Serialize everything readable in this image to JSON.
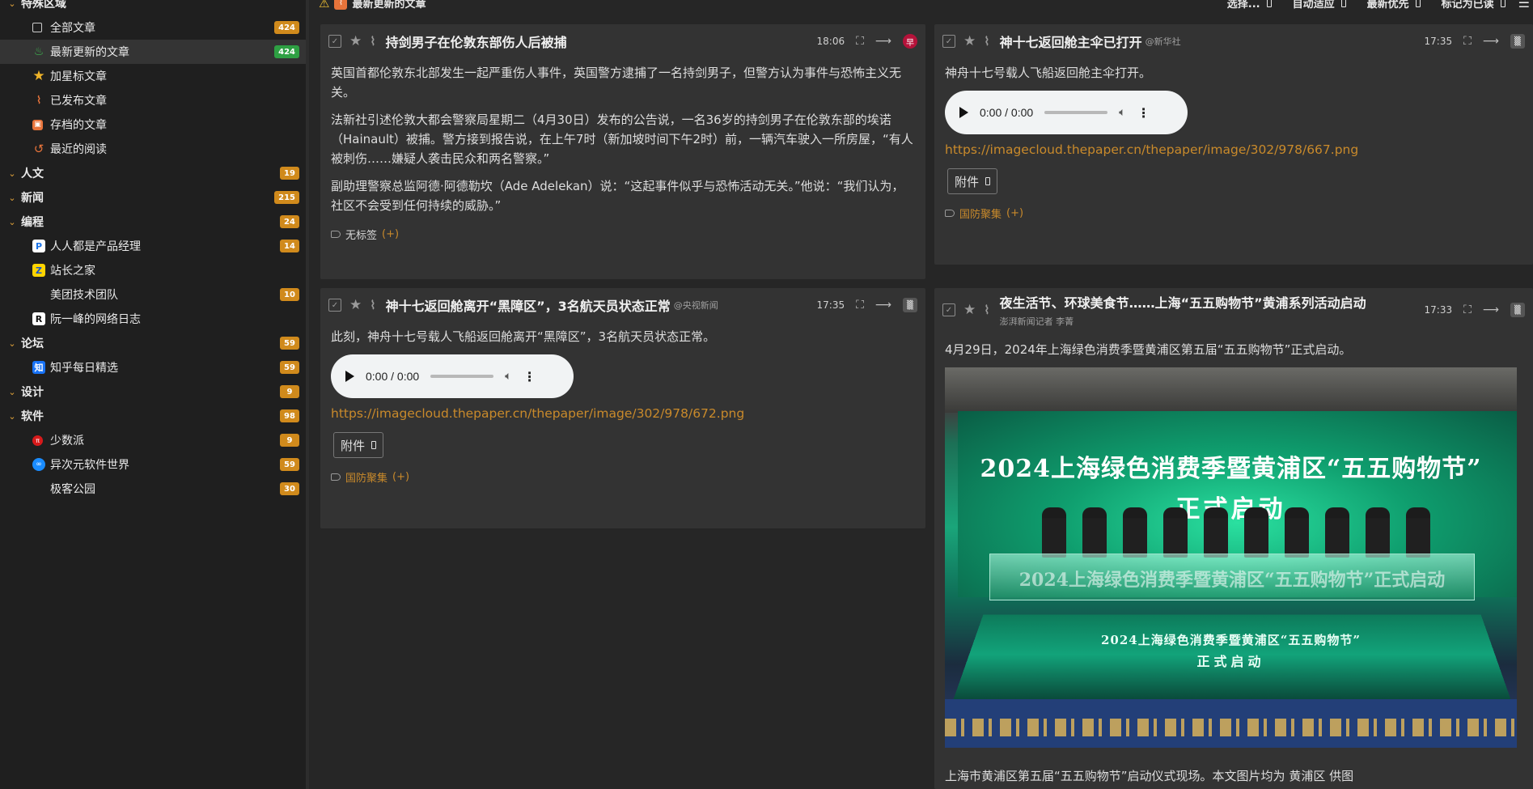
{
  "topbar": {
    "feed_title": "最新更新的文章",
    "actions": [
      "选择...",
      "自动适应",
      "最新优先",
      "标记为已读"
    ]
  },
  "sidebar": {
    "items": [
      {
        "label": "特殊区域",
        "type": "cat"
      },
      {
        "label": "全部文章",
        "badge": "424",
        "icon": "all-articles-icon"
      },
      {
        "label": "最新更新的文章",
        "badge": "424",
        "badge_color": "green",
        "icon": "fresh-icon",
        "active": true
      },
      {
        "label": "加星标文章",
        "icon": "star-icon"
      },
      {
        "label": "已发布文章",
        "icon": "rss-icon"
      },
      {
        "label": "存档的文章",
        "icon": "archive-icon"
      },
      {
        "label": "最近的阅读",
        "icon": "history-icon"
      },
      {
        "label": "人文",
        "badge": "19",
        "type": "cat"
      },
      {
        "label": "新闻",
        "badge": "215",
        "type": "cat"
      },
      {
        "label": "编程",
        "badge": "24",
        "type": "cat"
      },
      {
        "label": "人人都是产品经理",
        "badge": "14",
        "icon": "woshipm-icon"
      },
      {
        "label": "站长之家",
        "icon": "chinaz-icon"
      },
      {
        "label": "美团技术团队",
        "badge": "10"
      },
      {
        "label": "阮一峰的网络日志",
        "icon": "ruanyf-icon"
      },
      {
        "label": "论坛",
        "badge": "59",
        "type": "cat"
      },
      {
        "label": "知乎每日精选",
        "badge": "59",
        "icon": "zhihu-icon"
      },
      {
        "label": "设计",
        "badge": "9",
        "type": "cat"
      },
      {
        "label": "软件",
        "badge": "98",
        "type": "cat"
      },
      {
        "label": "少数派",
        "badge": "9",
        "icon": "sspai-icon"
      },
      {
        "label": "异次元软件世界",
        "badge": "59",
        "icon": "iplaysoft-icon"
      },
      {
        "label": "极客公园",
        "badge": "30"
      }
    ]
  },
  "cards": {
    "a1": {
      "title": "持剑男子在伦敦东部伤人后被捕",
      "time": "18:06",
      "paras": [
        "英国首都伦敦东北部发生一起严重伤人事件，英国警方逮捕了一名持剑男子，但警方认为事件与恐怖主义无关。",
        "法新社引述伦敦大都会警察局星期二（4月30日）发布的公告说，一名36岁的持剑男子在伦敦东部的埃诺（Hainault）被捕。警方接到报告说，在上午7时（新加坡时间下午2时）前，一辆汽车驶入一所房屋，“有人被刺伤……嫌疑人袭击民众和两名警察。”",
        "副助理警察总监阿德·阿德勒坎（Ade Adelekan）说：“这起事件似乎与恐怖活动无关。”他说：“我们认为，社区不会受到任何持续的威胁。”"
      ],
      "tag": "无标签",
      "tag_add": "(+)"
    },
    "a2": {
      "title": "神十七返回舱离开“黑障区”，3名航天员状态正常",
      "source": "@央视新闻",
      "time": "17:35",
      "para": "此刻，神舟十七号载人飞船返回舱离开“黑障区”，3名航天员状态正常。",
      "audio_time": "0:00 / 0:00",
      "link": "https://imagecloud.thepaper.cn/thepaper/image/302/978/672.png",
      "attach": "附件",
      "tag": "国防聚集",
      "tag_add": "(+)"
    },
    "b1": {
      "title": "神十七返回舱主伞已打开",
      "source": "@新华社",
      "time": "17:35",
      "para": "神舟十七号载人飞船返回舱主伞打开。",
      "audio_time": "0:00 / 0:00",
      "link": "https://imagecloud.thepaper.cn/thepaper/image/302/978/667.png",
      "attach": "附件",
      "tag": "国防聚集",
      "tag_add": "(+)"
    },
    "b2": {
      "title": "夜生活节、环球美食节……上海“五五购物节”黄浦系列活动启动",
      "source": "澎湃新闻记者 李菁",
      "time": "17:33",
      "para": "4月29日，2024年上海绿色消费季暨黄浦区第五届“五五购物节”正式启动。",
      "photo_line1": "2024上海绿色消费季暨黄浦区“五五购物节”",
      "photo_line2": "正式启动",
      "photo_podium": "2024上海绿色消费季暨黄浦区“五五购物节”正式启动",
      "photo_stage1": "2024上海绿色消费季暨黄浦区“五五购物节”",
      "photo_stage2": "正式启动",
      "caption": "上海市黄浦区第五届“五五购物节”启动仪式现场。本文图片均为 黄浦区 供图"
    }
  }
}
